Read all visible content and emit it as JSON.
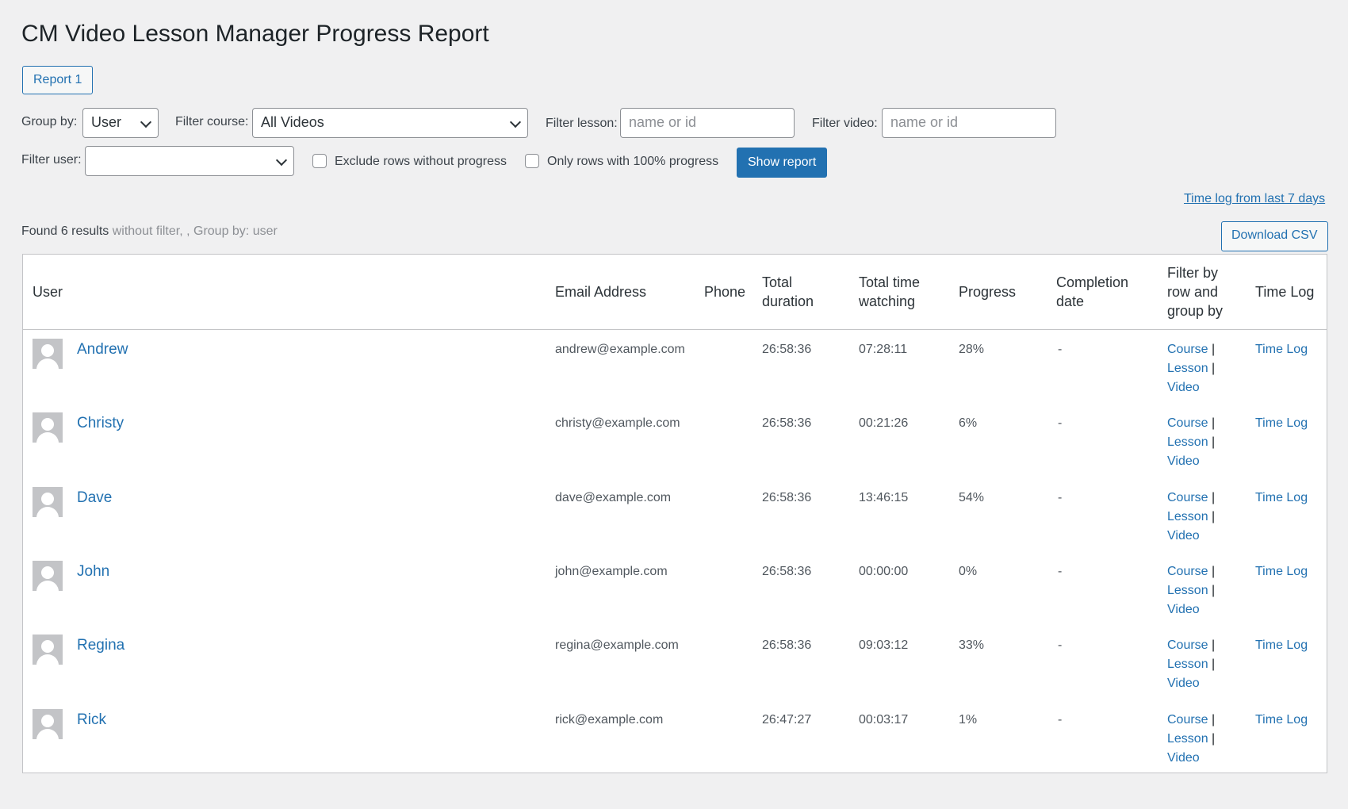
{
  "page": {
    "title": "CM Video Lesson Manager Progress Report",
    "report_tab": "Report 1"
  },
  "filters": {
    "group_by_label": "Group by:",
    "group_by_value": "User",
    "course_label": "Filter course:",
    "course_value": "All Videos",
    "lesson_label": "Filter lesson:",
    "lesson_placeholder": "name or id",
    "video_label": "Filter video:",
    "video_placeholder": "name or id",
    "user_label": "Filter user:",
    "user_value": "",
    "exclude_label": "Exclude rows without progress",
    "only100_label": "Only rows with 100% progress",
    "show_report": "Show report"
  },
  "toolbar": {
    "time_log_link": "Time log from last 7 days",
    "download_csv": "Download CSV",
    "found_main": "Found 6 results",
    "found_detail": " without filter, , Group by: user"
  },
  "table": {
    "headers": {
      "user": "User",
      "email": "Email Address",
      "phone": "Phone",
      "total_duration_1": "Total",
      "total_duration_2": "duration",
      "total_time_1": "Total time",
      "total_time_2": "watching",
      "progress": "Progress",
      "completion_1": "Completion",
      "completion_2": "date",
      "filter_1": "Filter by",
      "filter_2": "row and",
      "filter_3": "group by",
      "time_log": "Time Log"
    },
    "link_labels": {
      "course": "Course",
      "lesson": "Lesson",
      "video": "Video",
      "sep": "|",
      "time_log": "Time Log"
    },
    "rows": [
      {
        "user": "Andrew",
        "email": "andrew@example.com",
        "phone": "",
        "duration": "26:58:36",
        "watching": "07:28:11",
        "progress": "28%",
        "completion": "-"
      },
      {
        "user": "Christy",
        "email": "christy@example.com",
        "phone": "",
        "duration": "26:58:36",
        "watching": "00:21:26",
        "progress": "6%",
        "completion": "-"
      },
      {
        "user": "Dave",
        "email": "dave@example.com",
        "phone": "",
        "duration": "26:58:36",
        "watching": "13:46:15",
        "progress": "54%",
        "completion": "-"
      },
      {
        "user": "John",
        "email": "john@example.com",
        "phone": "",
        "duration": "26:58:36",
        "watching": "00:00:00",
        "progress": "0%",
        "completion": "-"
      },
      {
        "user": "Regina",
        "email": "regina@example.com",
        "phone": "",
        "duration": "26:58:36",
        "watching": "09:03:12",
        "progress": "33%",
        "completion": "-"
      },
      {
        "user": "Rick",
        "email": "rick@example.com",
        "phone": "",
        "duration": "26:47:27",
        "watching": "00:03:17",
        "progress": "1%",
        "completion": "-"
      }
    ]
  }
}
